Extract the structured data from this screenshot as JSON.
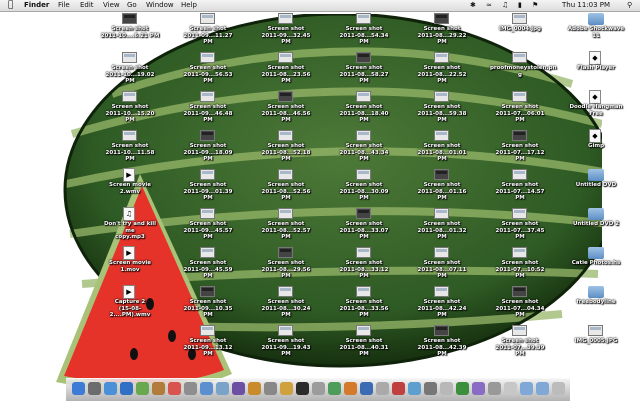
{
  "menubar": {
    "app_name": "Finder",
    "menus": [
      "File",
      "Edit",
      "View",
      "Go",
      "Window",
      "Help"
    ],
    "clock": "Thu 11:03 PM"
  },
  "desktop": {
    "columns": [
      {
        "items": [
          {
            "label": "Screen shot\n2011-10....6.21 PM",
            "kind": "shot"
          },
          {
            "label": "Screen shot\n2011-10...19.02 PM",
            "kind": "shot"
          },
          {
            "label": "Screen shot\n2011-10...15.20 PM",
            "kind": "shot"
          },
          {
            "label": "Screen shot\n2011-10...11.58 PM",
            "kind": "shot"
          },
          {
            "label": "Screen movie 2.wmv",
            "kind": "movie"
          },
          {
            "label": "Don't try and kill me\ncopy.mp3",
            "kind": "audio"
          },
          {
            "label": "Screen movie 1.mov",
            "kind": "movie"
          },
          {
            "label": "Capture 2\n(15-08-2....PM).wmv",
            "kind": "movie"
          }
        ]
      },
      {
        "items": [
          {
            "label": "Screen shot\n2011-09...11.27 PM",
            "kind": "shot"
          },
          {
            "label": "Screen shot\n2011-09...56.53 PM",
            "kind": "shot"
          },
          {
            "label": "Screen shot\n2011-09...46.48 PM",
            "kind": "shot"
          },
          {
            "label": "Screen shot\n2011-09...18.09 PM",
            "kind": "shot"
          },
          {
            "label": "Screen shot\n2011-09...01.39 PM",
            "kind": "shot"
          },
          {
            "label": "Screen shot\n2011-09...45.57 PM",
            "kind": "shot"
          },
          {
            "label": "Screen shot\n2011-09...45.59 PM",
            "kind": "shot"
          },
          {
            "label": "Screen shot\n2011-09...10.35 PM",
            "kind": "shot"
          },
          {
            "label": "Screen shot\n2011-09...13.12 PM",
            "kind": "shot"
          }
        ]
      },
      {
        "items": [
          {
            "label": "Screen shot\n2011-09...32.45 PM",
            "kind": "shot"
          },
          {
            "label": "Screen shot\n2011-08...23.56 PM",
            "kind": "shot"
          },
          {
            "label": "Screen shot\n2011-08...46.56 PM",
            "kind": "shot"
          },
          {
            "label": "Screen shot\n2011-08...52.18 PM",
            "kind": "shot"
          },
          {
            "label": "Screen shot\n2011-08...52.56 PM",
            "kind": "shot"
          },
          {
            "label": "Screen shot\n2011-08...52.57 PM",
            "kind": "shot"
          },
          {
            "label": "Screen shot\n2011-08...29.56 PM",
            "kind": "shot"
          },
          {
            "label": "Screen shot\n2011-08...30.24 PM",
            "kind": "shot"
          },
          {
            "label": "Screen shot\n2011-09...19.43 PM",
            "kind": "shot"
          }
        ]
      },
      {
        "items": [
          {
            "label": "Screen shot\n2011-08...54.34 PM",
            "kind": "shot"
          },
          {
            "label": "Screen shot\n2011-08...58.27 PM",
            "kind": "shot"
          },
          {
            "label": "Screen shot\n2011-08...18.40 PM",
            "kind": "shot"
          },
          {
            "label": "Screen shot\n2011-08...43.34 PM",
            "kind": "shot"
          },
          {
            "label": "Screen shot\n2011-08...30.09 PM",
            "kind": "shot"
          },
          {
            "label": "Screen shot\n2011-08...33.07 PM",
            "kind": "shot"
          },
          {
            "label": "Screen shot\n2011-08...33.12 PM",
            "kind": "shot"
          },
          {
            "label": "Screen shot\n2011-08...33.56 PM",
            "kind": "shot"
          },
          {
            "label": "Screen shot\n2011-08...40.31 PM",
            "kind": "shot"
          }
        ]
      },
      {
        "items": [
          {
            "label": "Screen shot\n2011-08...29.22 PM",
            "kind": "shot"
          },
          {
            "label": "Screen shot\n2011-08...22.52 PM",
            "kind": "shot"
          },
          {
            "label": "Screen shot\n2011-08...59.38 PM",
            "kind": "shot"
          },
          {
            "label": "Screen shot\n2011-08...01.01 PM",
            "kind": "shot"
          },
          {
            "label": "Screen shot\n2011-08...01.16 PM",
            "kind": "shot"
          },
          {
            "label": "Screen shot\n2011-08...01.32 PM",
            "kind": "shot"
          },
          {
            "label": "Screen shot\n2011-08...07.11 PM",
            "kind": "shot"
          },
          {
            "label": "Screen shot\n2011-08...42.24 PM",
            "kind": "shot"
          },
          {
            "label": "Screen shot\n2011-08...42.39 PM",
            "kind": "shot"
          }
        ]
      },
      {
        "items": [
          {
            "label": "IMG_0004.jpg",
            "kind": "shot"
          },
          {
            "label": "proofmoneystolen.pn\ng",
            "kind": "shot"
          },
          {
            "label": "Screen shot\n2011-07...06.01 PM",
            "kind": "shot"
          },
          {
            "label": "Screen shot\n2011-07...17.12 PM",
            "kind": "shot"
          },
          {
            "label": "Screen shot\n2011-07...14.57 PM",
            "kind": "shot"
          },
          {
            "label": "Screen shot\n2011-07...37.45 PM",
            "kind": "shot"
          },
          {
            "label": "Screen shot\n2011-07...10.52 PM",
            "kind": "shot"
          },
          {
            "label": "Screen shot\n2011-07...04.34 PM",
            "kind": "shot"
          },
          {
            "label": "Screen shot\n2011-07...39.39 PM",
            "kind": "shot"
          }
        ]
      },
      {
        "items": [
          {
            "label": "Adobe Shockwave 11",
            "kind": "folder"
          },
          {
            "label": "Flash Player",
            "kind": "app"
          },
          {
            "label": "Doodle Hangman\nFree",
            "kind": "app"
          },
          {
            "label": "Gimp",
            "kind": "app"
          },
          {
            "label": "Untitled DVD",
            "kind": "folder"
          },
          {
            "label": "Untitled DVD 2",
            "kind": "folder"
          },
          {
            "label": "Catie Photos.hs",
            "kind": "folder"
          },
          {
            "label": "freebodyline",
            "kind": "folder"
          },
          {
            "label": "IMG_0005.JPG",
            "kind": "shot"
          }
        ]
      }
    ]
  },
  "colors": {
    "melon_rind": "#2e5a24",
    "melon_stripe": "#98b86a",
    "melon_flesh": "#e6332a",
    "melon_light": "#a8c278"
  },
  "dock": {
    "icons": [
      "finder-icon",
      "dashboard-icon",
      "mail-icon",
      "safari-icon",
      "ichat-icon",
      "address-book-icon",
      "ical-icon",
      "preview-icon",
      "itunes-icon",
      "iphoto-icon",
      "imovie-icon",
      "garageband-icon",
      "system-preferences-icon",
      "spotlight-icon",
      "terminal-icon",
      "automator-icon",
      "app-icon",
      "app-icon",
      "app-icon",
      "app-icon",
      "app-icon",
      "app-icon",
      "app-icon",
      "app-icon",
      "app-icon",
      "app-icon",
      "app-icon",
      "app-icon",
      "downloads-folder-icon",
      "documents-folder-icon",
      "trash-icon"
    ]
  }
}
